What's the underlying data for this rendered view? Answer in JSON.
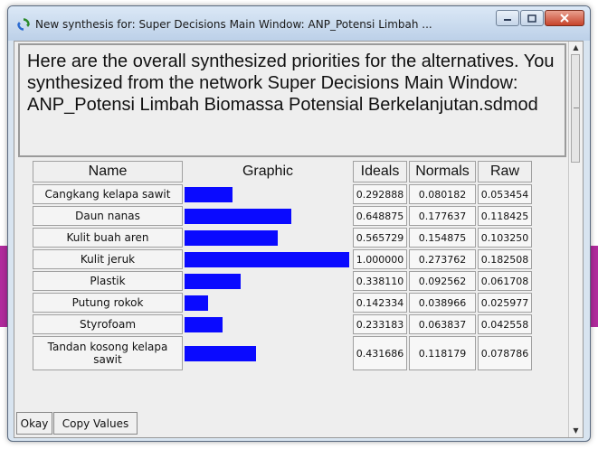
{
  "window": {
    "title": "New synthesis for: Super Decisions Main Window: ANP_Potensi Limbah ...",
    "controls": [
      "minimize",
      "maximize",
      "close"
    ]
  },
  "description": "Here are the overall synthesized priorities for the alternatives. You synthesized from the network Super Decisions Main Window: ANP_Potensi Limbah Biomassa Potensial Berkelanjutan.sdmod",
  "table": {
    "headers": {
      "name": "Name",
      "graphic": "Graphic",
      "ideals": "Ideals",
      "normals": "Normals",
      "raw": "Raw"
    },
    "rows": [
      {
        "name": "Cangkang kelapa sawit",
        "ideals": "0.292888",
        "normals": "0.080182",
        "raw": "0.053454",
        "bar": 0.292888
      },
      {
        "name": "Daun nanas",
        "ideals": "0.648875",
        "normals": "0.177637",
        "raw": "0.118425",
        "bar": 0.648875
      },
      {
        "name": "Kulit buah aren",
        "ideals": "0.565729",
        "normals": "0.154875",
        "raw": "0.103250",
        "bar": 0.565729
      },
      {
        "name": "Kulit jeruk",
        "ideals": "1.000000",
        "normals": "0.273762",
        "raw": "0.182508",
        "bar": 1.0
      },
      {
        "name": "Plastik",
        "ideals": "0.338110",
        "normals": "0.092562",
        "raw": "0.061708",
        "bar": 0.33811
      },
      {
        "name": "Putung rokok",
        "ideals": "0.142334",
        "normals": "0.038966",
        "raw": "0.025977",
        "bar": 0.142334
      },
      {
        "name": "Styrofoam",
        "ideals": "0.233183",
        "normals": "0.063837",
        "raw": "0.042558",
        "bar": 0.233183
      },
      {
        "name": "Tandan kosong kelapa sawit",
        "ideals": "0.431686",
        "normals": "0.118179",
        "raw": "0.078786",
        "bar": 0.431686
      }
    ]
  },
  "buttons": {
    "okay": "Okay",
    "copy_values": "Copy Values"
  },
  "colors": {
    "bar": "#0a0aff",
    "accent_strip": "#b02a9c"
  },
  "icons": {
    "app": "refresh-arrows-icon"
  }
}
